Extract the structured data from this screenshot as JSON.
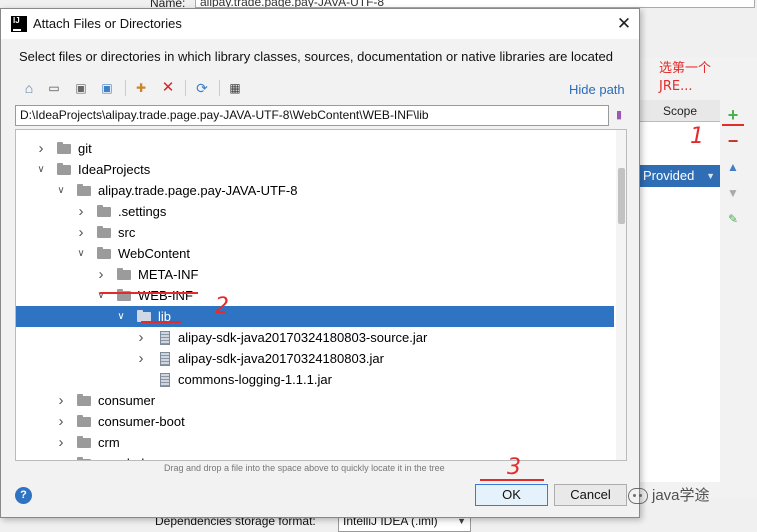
{
  "background_window": {
    "name_label": "Name:",
    "name_value": "alipay.trade.page.pay-JAVA-UTF-8",
    "scope_header": "Scope",
    "provided_value": "Provided",
    "add_icon": "plus-icon",
    "remove_icon": "minus-icon",
    "up_icon": "arrow-up-icon",
    "down_icon": "arrow-down-icon",
    "edit_icon": "pencil-icon",
    "deps_storage_label": "Dependencies storage format:",
    "deps_storage_value": "IntelliJ IDEA (.iml)"
  },
  "annotations": {
    "choose_first_jre": "选第一个\nJRE...",
    "step1": "1",
    "step2": "2",
    "step3": "3"
  },
  "watermark": "java学途",
  "dialog": {
    "title": "Attach Files or Directories",
    "logo_letters": "IJ",
    "close_label": "✕",
    "description": "Select files or directories in which library classes, sources, documentation or native libraries are located",
    "hide_path_label": "Hide path",
    "path_value": "D:\\IdeaProjects\\alipay.trade.page.pay-JAVA-UTF-8\\WebContent\\WEB-INF\\lib",
    "drag_hint": "Drag and drop a file into the space above to quickly locate it in the tree",
    "ok_label": "OK",
    "cancel_label": "Cancel",
    "help_label": "?",
    "toolbar": {
      "home_icon": "home-icon",
      "desktop_icon": "desktop-icon",
      "project_icon": "project-icon",
      "module_icon": "module-icon",
      "new_folder_icon": "new-folder-icon",
      "delete_icon": "delete-icon",
      "refresh_icon": "refresh-icon",
      "show_hidden_icon": "show-hidden-icon"
    },
    "tree": [
      {
        "label": "git",
        "depth": 1,
        "expanded": false,
        "type": "folder"
      },
      {
        "label": "IdeaProjects",
        "depth": 1,
        "expanded": true,
        "type": "folder"
      },
      {
        "label": "alipay.trade.page.pay-JAVA-UTF-8",
        "depth": 2,
        "expanded": true,
        "type": "folder"
      },
      {
        "label": ".settings",
        "depth": 3,
        "expanded": false,
        "type": "folder"
      },
      {
        "label": "src",
        "depth": 3,
        "expanded": false,
        "type": "folder"
      },
      {
        "label": "WebContent",
        "depth": 3,
        "expanded": true,
        "type": "folder"
      },
      {
        "label": "META-INF",
        "depth": 4,
        "expanded": false,
        "type": "folder"
      },
      {
        "label": "WEB-INF",
        "depth": 4,
        "expanded": true,
        "type": "folder"
      },
      {
        "label": "lib",
        "depth": 5,
        "expanded": true,
        "type": "folder",
        "selected": true
      },
      {
        "label": "alipay-sdk-java20170324180803-source.jar",
        "depth": 6,
        "expanded": false,
        "type": "jar"
      },
      {
        "label": "alipay-sdk-java20170324180803.jar",
        "depth": 6,
        "expanded": false,
        "type": "jar"
      },
      {
        "label": "commons-logging-1.1.1.jar",
        "depth": 6,
        "expanded": false,
        "type": "jar",
        "no_arrow": true
      },
      {
        "label": "consumer",
        "depth": 2,
        "expanded": false,
        "type": "folder"
      },
      {
        "label": "consumer-boot",
        "depth": 2,
        "expanded": false,
        "type": "folder"
      },
      {
        "label": "crm",
        "depth": 2,
        "expanded": false,
        "type": "folder"
      },
      {
        "label": "crm_bak",
        "depth": 2,
        "expanded": false,
        "type": "folder"
      }
    ],
    "colors": {
      "selection": "#2f74c2",
      "link": "#2a6bb8",
      "annotation": "#e32b2b"
    }
  }
}
